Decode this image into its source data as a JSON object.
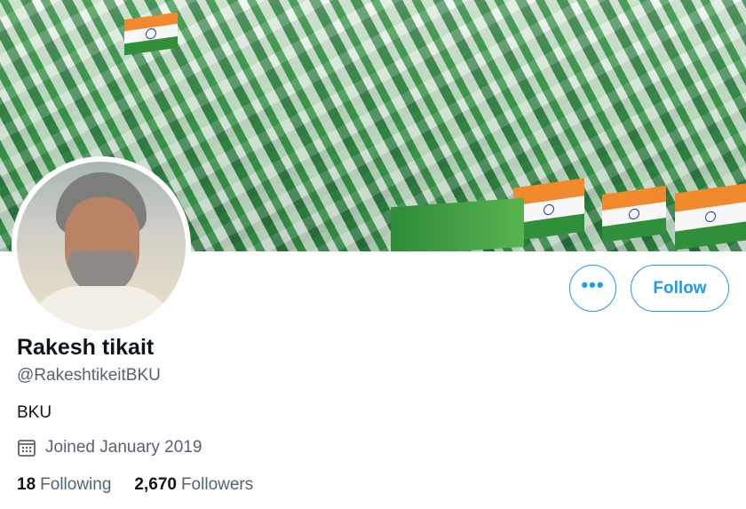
{
  "profile": {
    "display_name": "Rakesh tikait",
    "handle": "@RakeshtikeitBKU",
    "bio": "BKU",
    "joined": "Joined January 2019",
    "avatar_icon": "profile-photo"
  },
  "actions": {
    "more_label": "•••",
    "follow_label": "Follow"
  },
  "stats": {
    "following_count": "18",
    "following_label": "Following",
    "followers_count": "2,670",
    "followers_label": "Followers"
  },
  "colors": {
    "accent": "#1d9bf0",
    "text_primary": "#0f1419",
    "text_secondary": "#536471"
  },
  "icons": {
    "joined": "calendar-icon"
  }
}
